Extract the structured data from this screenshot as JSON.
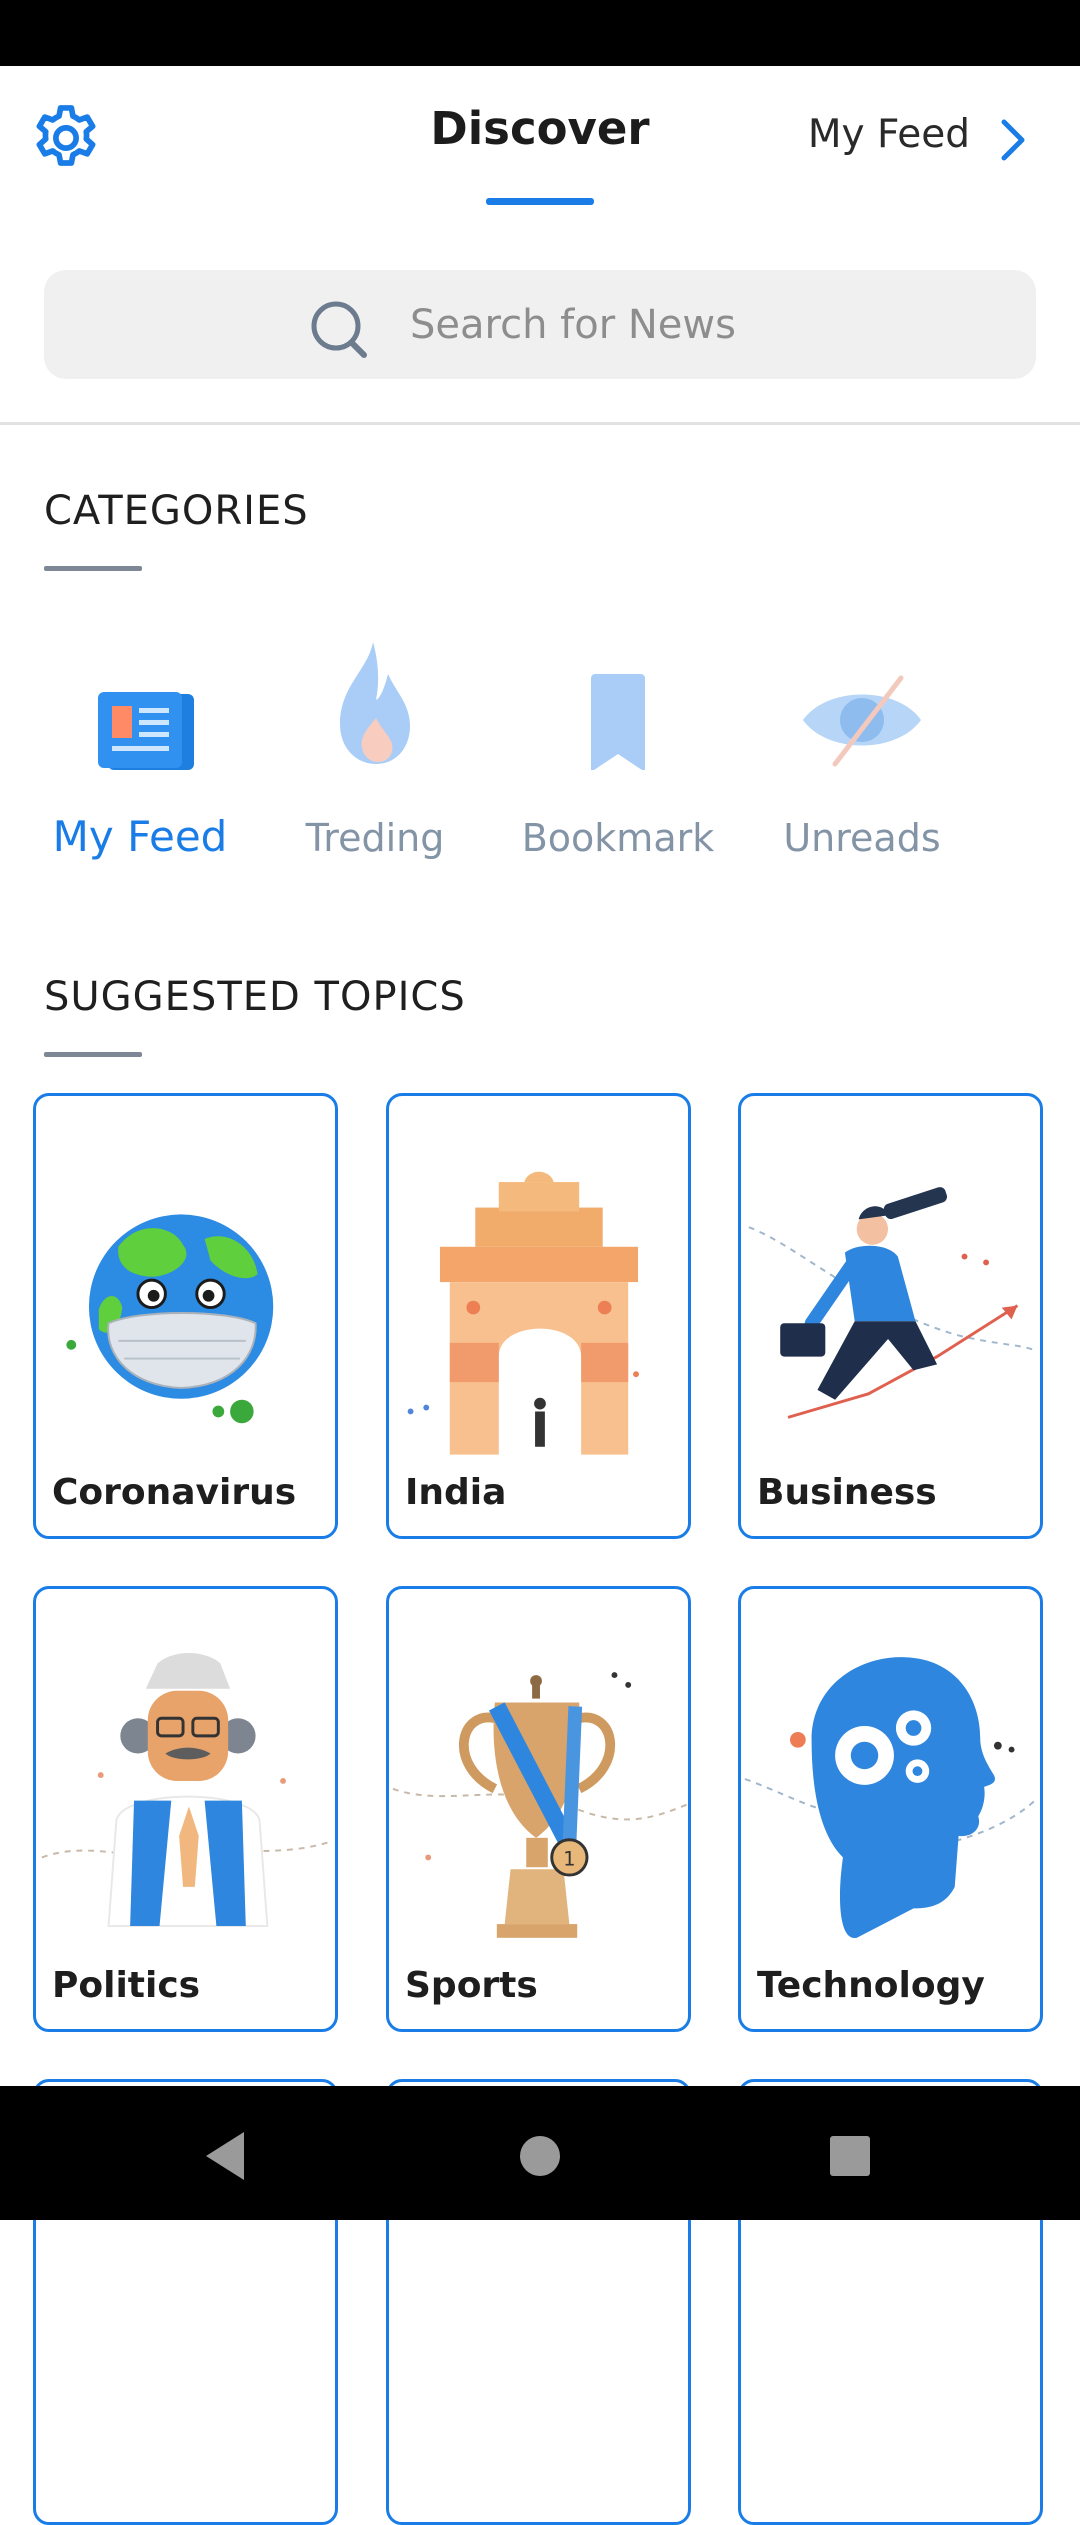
{
  "header": {
    "settings_icon": "gear-icon",
    "active_tab": "Discover",
    "next_tab": "My Feed",
    "next_icon": "chevron-right-icon"
  },
  "search": {
    "placeholder": "Search for News",
    "value": "",
    "icon": "search-icon"
  },
  "categories": {
    "title": "CATEGORIES",
    "items": [
      {
        "label": "My Feed",
        "icon": "newspaper-icon",
        "active": true
      },
      {
        "label": "Treding",
        "icon": "flame-icon",
        "active": false
      },
      {
        "label": "Bookmark",
        "icon": "bookmark-icon",
        "active": false
      },
      {
        "label": "Unreads",
        "icon": "eye-slash-icon",
        "active": false
      }
    ]
  },
  "suggested_topics": {
    "title": "SUGGESTED TOPICS",
    "items": [
      {
        "label": "Coronavirus",
        "image": "earth-with-mask-illustration"
      },
      {
        "label": "India",
        "image": "india-gate-illustration"
      },
      {
        "label": "Business",
        "image": "businessman-with-telescope-illustration"
      },
      {
        "label": "Politics",
        "image": "politician-illustration"
      },
      {
        "label": "Sports",
        "image": "trophy-illustration"
      },
      {
        "label": "Technology",
        "image": "head-with-gears-illustration"
      }
    ]
  },
  "colors": {
    "accent": "#1a7de7",
    "card_border": "#1a7de7",
    "inactive_label": "#8494a7",
    "search_bg": "#f0f0f0"
  },
  "navigation": {
    "back_icon": "back-triangle-icon",
    "home_icon": "home-circle-icon",
    "recents_icon": "recents-square-icon"
  }
}
